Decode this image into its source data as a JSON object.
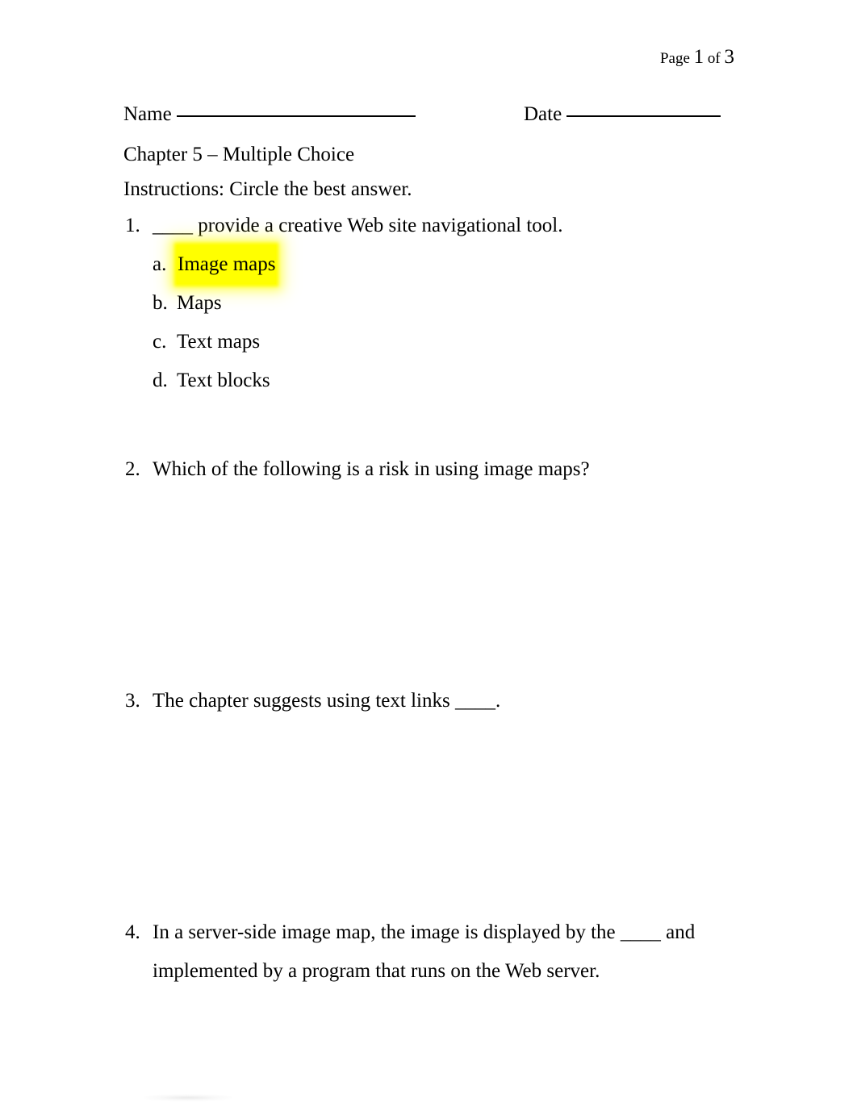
{
  "document": {
    "header": {
      "page_prefix": "Page",
      "page_number": "1",
      "page_connector": "of",
      "page_total": "3"
    },
    "fields": {
      "name_label": "Name",
      "date_label": "Date"
    },
    "title": "Chapter 5 – Multiple Choice",
    "instructions": "Instructions: Circle the best answer.",
    "questions": [
      {
        "number": "1.",
        "text": "____ provide a creative Web site navigational tool.",
        "choices": [
          {
            "letter": "a.",
            "text": "Image maps",
            "highlighted": true
          },
          {
            "letter": "b.",
            "text": "Maps",
            "highlighted": false
          },
          {
            "letter": "c.",
            "text": "Text maps",
            "highlighted": false
          },
          {
            "letter": "d.",
            "text": "Text blocks",
            "highlighted": false
          }
        ]
      },
      {
        "number": "2.",
        "text": "Which of the following is a risk in using image maps?",
        "choices": []
      },
      {
        "number": "3.",
        "text": "The chapter suggests using text links ____.",
        "choices": []
      },
      {
        "number": "4.",
        "text": "In a server-side image map, the image is displayed by the ____ and implemented by a program that runs on the Web server.",
        "choices": []
      }
    ]
  }
}
